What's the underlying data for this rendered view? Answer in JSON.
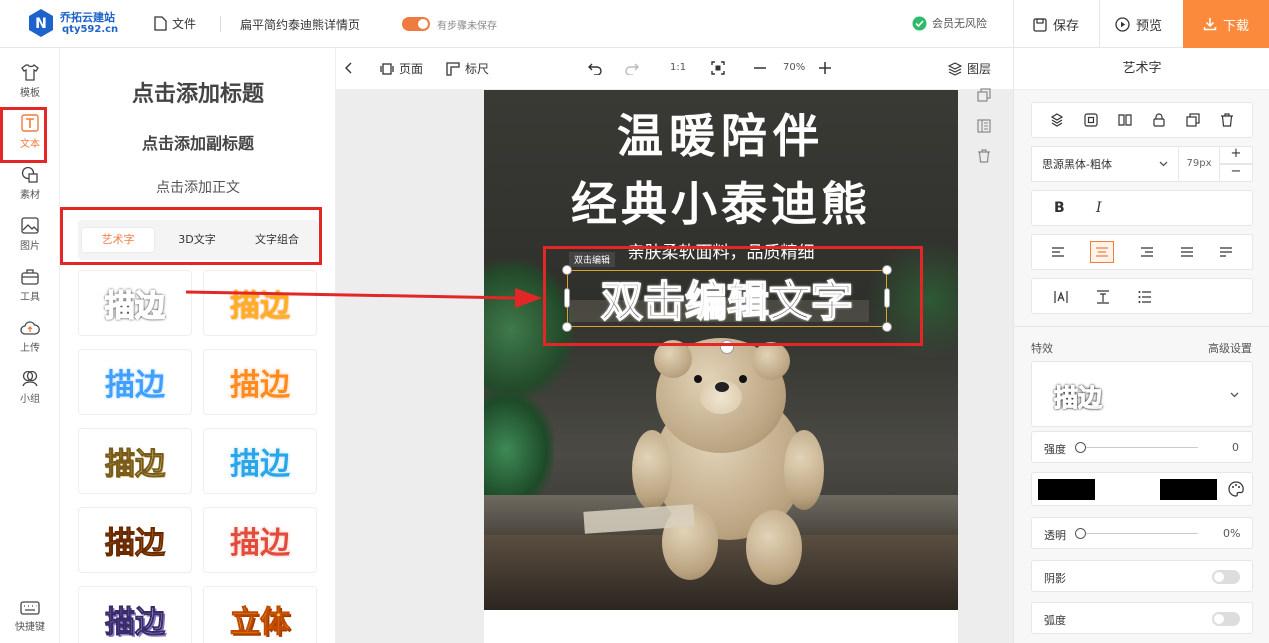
{
  "topbar": {
    "brand_name": "乔拓云建站",
    "brand_domain": "qty592.cn",
    "file_label": "文件",
    "doc_title": "扁平简约泰迪熊详情页",
    "autosave_label": "有步骤未保存",
    "member_label": "会员无风险",
    "save_label": "保存",
    "preview_label": "预览",
    "download_label": "下载"
  },
  "leftbar": {
    "items": [
      {
        "label": "模板"
      },
      {
        "label": "文本"
      },
      {
        "label": "素材"
      },
      {
        "label": "图片"
      },
      {
        "label": "工具"
      },
      {
        "label": "上传"
      },
      {
        "label": "小组"
      }
    ],
    "shortcut_label": "快捷键"
  },
  "panel": {
    "add_title": "点击添加标题",
    "add_subtitle": "点击添加副标题",
    "add_body": "点击添加正文",
    "tabs": [
      "艺术字",
      "3D文字",
      "文字组合"
    ],
    "thumbs": [
      "描边",
      "描边",
      "描边",
      "描边",
      "描边",
      "描边",
      "描边",
      "描边",
      "描边",
      "立体"
    ]
  },
  "canvasbar": {
    "page_label": "页面",
    "ruler_label": "标尺",
    "ratio_label": "1:1",
    "zoom_value": "70%",
    "layers_label": "图层"
  },
  "artboard": {
    "headline_1": "温暖陪伴",
    "headline_2": "经典小泰迪熊",
    "subline": "亲肤柔软面料，品质精细",
    "selected_text": "双击编辑文字",
    "edit_hint": "双击编辑"
  },
  "rightpanel": {
    "header": "艺术字",
    "font_name": "思源黑体-粗体",
    "font_size": "79px",
    "effects_label": "特效",
    "advanced_label": "高级设置",
    "effect_preview": "描边",
    "strength_label": "强度",
    "strength_value": "0",
    "opacity_label": "透明",
    "opacity_value": "0%",
    "shadow_label": "阴影",
    "arc_label": "弧度"
  },
  "colors": {
    "accent": "#fb8a3c",
    "highlight": "#e32626",
    "brand": "#1e63c9"
  }
}
